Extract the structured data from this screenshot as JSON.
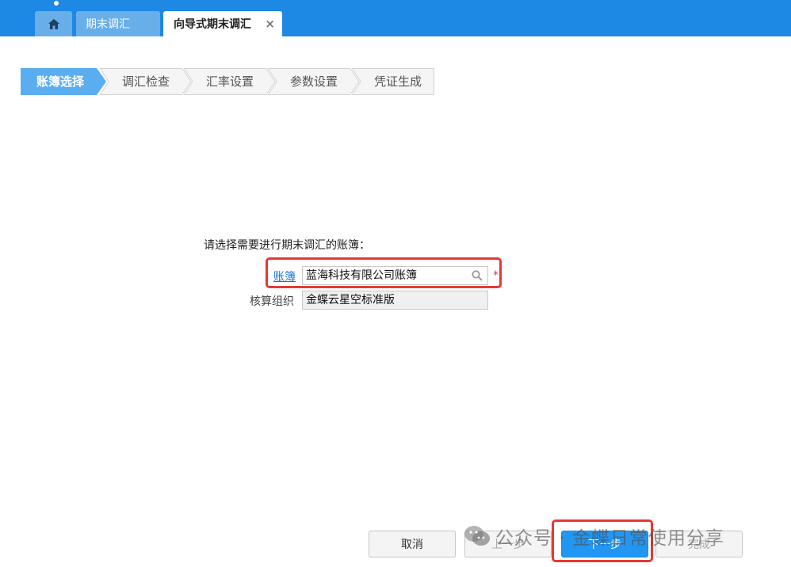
{
  "tabs": {
    "home_icon": "home-icon",
    "tab1": "期末调汇",
    "tab2": "向导式期末调汇",
    "close_glyph": "×"
  },
  "steps": [
    "账簿选择",
    "调汇检查",
    "汇率设置",
    "参数设置",
    "凭证生成"
  ],
  "active_step": 0,
  "form": {
    "prompt": "请选择需要进行期末调汇的账簿：",
    "book_label": "账簿",
    "book_value": "蓝海科技有限公司账簿",
    "required": "*",
    "org_label": "核算组织",
    "org_value": "金蝶云星空标准版"
  },
  "buttons": {
    "cancel": "取消",
    "prev": "上一步",
    "next": "下一步",
    "finish": "完成"
  },
  "watermark": "公众号 · 金蝶日常使用分享",
  "colors": {
    "primary": "#1e88e5",
    "active_step": "#5aaef0",
    "highlight": "#e53935"
  }
}
